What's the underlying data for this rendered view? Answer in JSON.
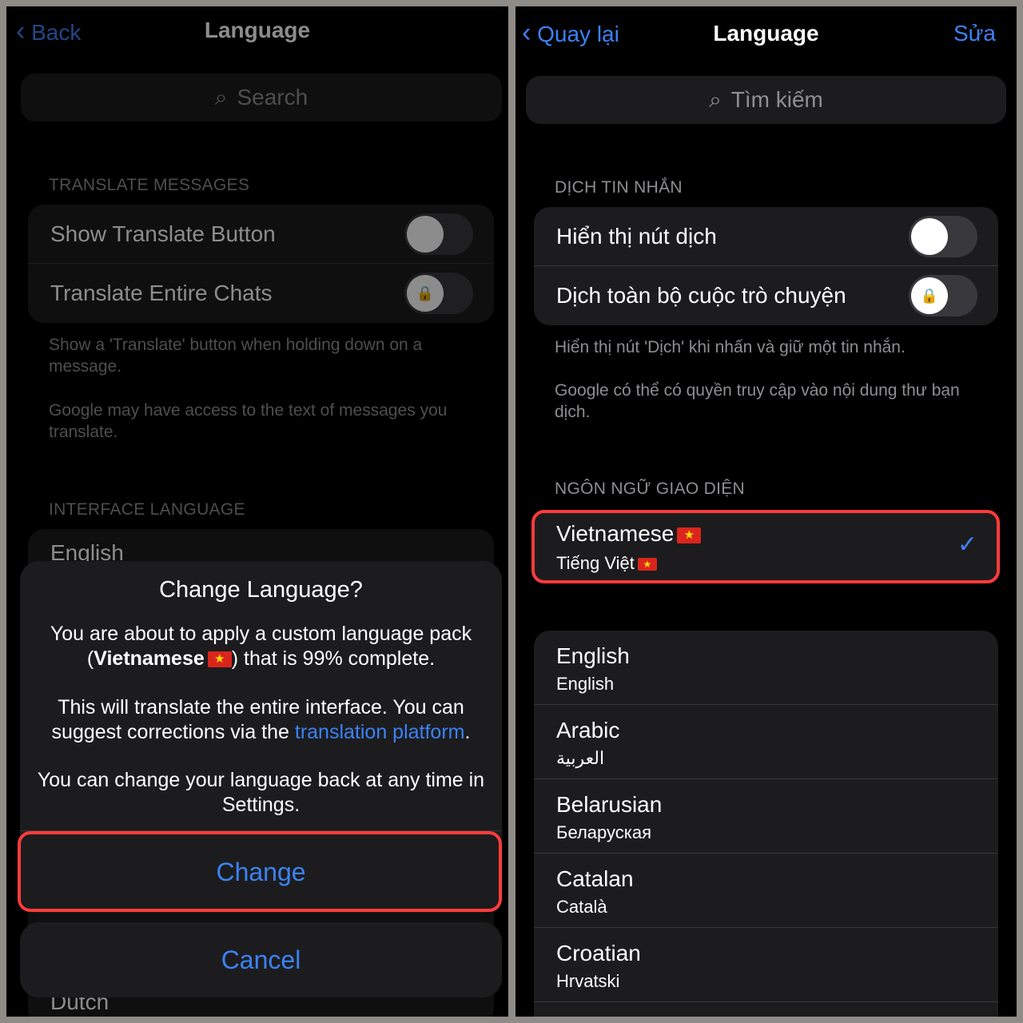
{
  "left": {
    "nav": {
      "back": "Back",
      "title": "Language"
    },
    "search_placeholder": "Search",
    "translate_section": "TRANSLATE MESSAGES",
    "rows": [
      "Show Translate Button",
      "Translate Entire Chats"
    ],
    "footer1": "Show a 'Translate' button when holding down on a message.",
    "footer2": "Google may have access to the text of messages you translate.",
    "interface_section": "INTERFACE LANGUAGE",
    "first_lang": "English",
    "last_lang": "Dutch",
    "dialog": {
      "title": "Change Language?",
      "p1_before": "You are about to apply a custom language pack (",
      "p1_bold": "Vietnamese",
      "p1_after": ") that is 99% complete.",
      "p2_before": "This will translate the entire interface. You can suggest corrections via the ",
      "p2_link": "translation platform",
      "p2_after": ".",
      "p3": "You can change your language back at any time in Settings.",
      "change": "Change",
      "cancel": "Cancel"
    }
  },
  "right": {
    "nav": {
      "back": "Quay lại",
      "title": "Language",
      "edit": "Sửa"
    },
    "search_placeholder": "Tìm kiếm",
    "translate_section": "DỊCH TIN NHẮN",
    "rows": [
      "Hiển thị nút dịch",
      "Dịch toàn bộ cuộc trò chuyện"
    ],
    "footer1": "Hiển thị nút 'Dịch' khi nhấn và giữ một tin nhắn.",
    "footer2": "Google có thể có quyền truy cập vào nội dung thư bạn dịch.",
    "interface_section": "NGÔN NGỮ GIAO DIỆN",
    "selected": {
      "name": "Vietnamese",
      "native": "Tiếng Việt"
    },
    "languages": [
      {
        "name": "English",
        "native": "English"
      },
      {
        "name": "Arabic",
        "native": "العربية"
      },
      {
        "name": "Belarusian",
        "native": "Беларуская"
      },
      {
        "name": "Catalan",
        "native": "Català"
      },
      {
        "name": "Croatian",
        "native": "Hrvatski"
      }
    ]
  },
  "colors": {
    "accent": "#3b82f6",
    "highlight": "#ff3b3b",
    "background": "#000000",
    "cell": "#1c1c1e"
  }
}
